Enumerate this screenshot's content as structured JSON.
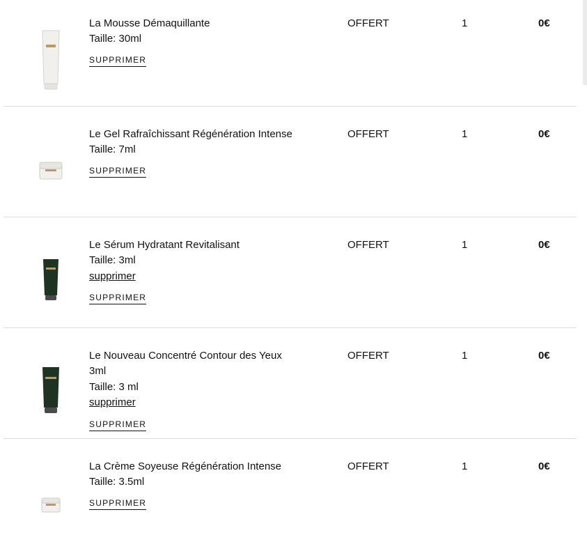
{
  "items": [
    {
      "name": "La Mousse Démaquillante",
      "size": "Taille: 30ml",
      "price": "OFFERT",
      "qty": "1",
      "total": "0€",
      "remove": "SUPPRIMER",
      "product_icon": "cleanser-tube-icon"
    },
    {
      "name": "Le Gel Rafraîchissant Régénération Intense",
      "size": "Taille: 7ml",
      "price": "OFFERT",
      "qty": "1",
      "total": "0€",
      "remove": "SUPPRIMER",
      "product_icon": "gel-jar-icon"
    },
    {
      "name": "Le Sérum Hydratant Revitalisant",
      "size": "Taille: 3ml",
      "link": "supprimer",
      "price": "OFFERT",
      "qty": "1",
      "total": "0€",
      "remove": "SUPPRIMER",
      "product_icon": "serum-tube-icon"
    },
    {
      "name": "Le Nouveau Concentré Contour des Yeux 3ml",
      "size": "Taille: 3 ml",
      "link": "supprimer",
      "price": "OFFERT",
      "qty": "1",
      "total": "0€",
      "remove": "SUPPRIMER",
      "product_icon": "eye-concentrate-tube-icon"
    },
    {
      "name": "La Crème Soyeuse Régénération Intense",
      "size": "Taille: 3.5ml",
      "price": "OFFERT",
      "qty": "1",
      "total": "0€",
      "remove": "SUPPRIMER",
      "product_icon": "cream-jar-icon"
    }
  ],
  "colors": {
    "text": "#111111",
    "divider": "#dcdcdc",
    "tube_white": "#f1f0ec",
    "tube_green": "#1f3322",
    "cap_dark": "#4a4a4a",
    "logo_gold": "#b89b6a"
  }
}
